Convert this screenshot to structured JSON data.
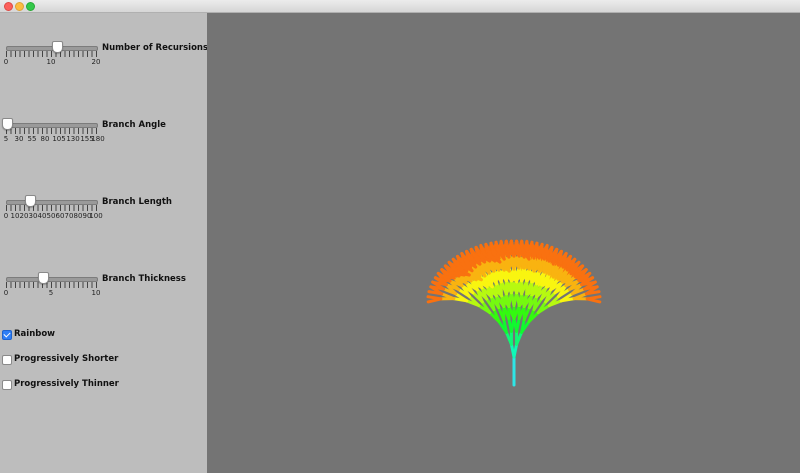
{
  "window": {
    "buttons": [
      "close",
      "minimize",
      "maximize"
    ]
  },
  "sliders": [
    {
      "label": "Number of Recursions",
      "min": 0,
      "max": 20,
      "value": 11,
      "ticks": [
        "0",
        "10",
        "20"
      ]
    },
    {
      "label": "Branch Angle",
      "min": 5,
      "max": 180,
      "value": 5,
      "ticks": [
        "5",
        "30",
        "55",
        "80",
        "105",
        "130",
        "155",
        "180"
      ]
    },
    {
      "label": "Branch  Length",
      "min": 0,
      "max": 100,
      "value": 25,
      "ticks": [
        "0",
        "10",
        "20",
        "30",
        "40",
        "50",
        "60",
        "70",
        "80",
        "90",
        "100"
      ]
    },
    {
      "label": "Branch  Thickness",
      "min": 0,
      "max": 10,
      "value": 4,
      "ticks": [
        "0",
        "5",
        "10"
      ]
    }
  ],
  "checkboxes": [
    {
      "label": "Rainbow",
      "checked": true
    },
    {
      "label": "Progressively Shorter",
      "checked": false
    },
    {
      "label": "Progressively Thinner",
      "checked": false
    }
  ],
  "canvas": {
    "background": "#747474",
    "trunk_color": "#2ee6e6"
  },
  "colors": {
    "sidebar": "#bdbdbd",
    "checkbox_accent": "#2e7ef6"
  }
}
